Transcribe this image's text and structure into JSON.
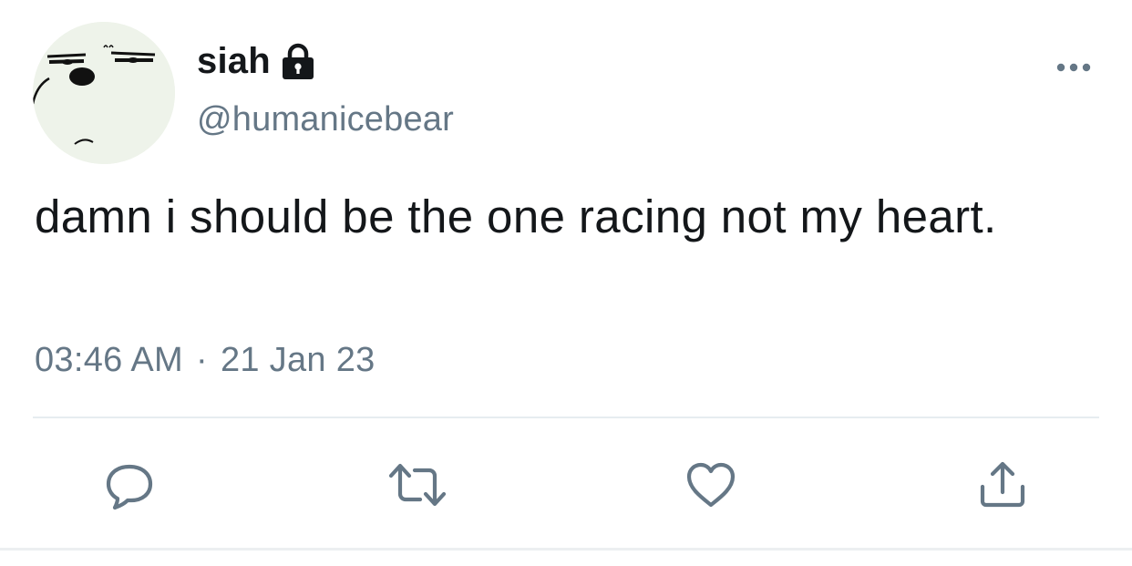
{
  "tweet": {
    "author": {
      "display_name": "siah",
      "handle": "@humanicebear",
      "protected_icon": "lock-icon",
      "avatar_icon": "bear-face-avatar"
    },
    "text": "damn i should be the one racing not my heart.",
    "timestamp": {
      "time": "03:46 AM",
      "separator": "·",
      "date": "21 Jan 23"
    },
    "more_icon": "more-horizontal-icon",
    "actions": [
      {
        "icon": "reply-icon"
      },
      {
        "icon": "retweet-icon"
      },
      {
        "icon": "like-icon"
      },
      {
        "icon": "share-icon"
      }
    ]
  },
  "colors": {
    "text_primary": "#14171a",
    "text_secondary": "#657786",
    "icon": "#657786",
    "divider": "#e6ecf0",
    "avatar_bg": "#eef3ea"
  }
}
